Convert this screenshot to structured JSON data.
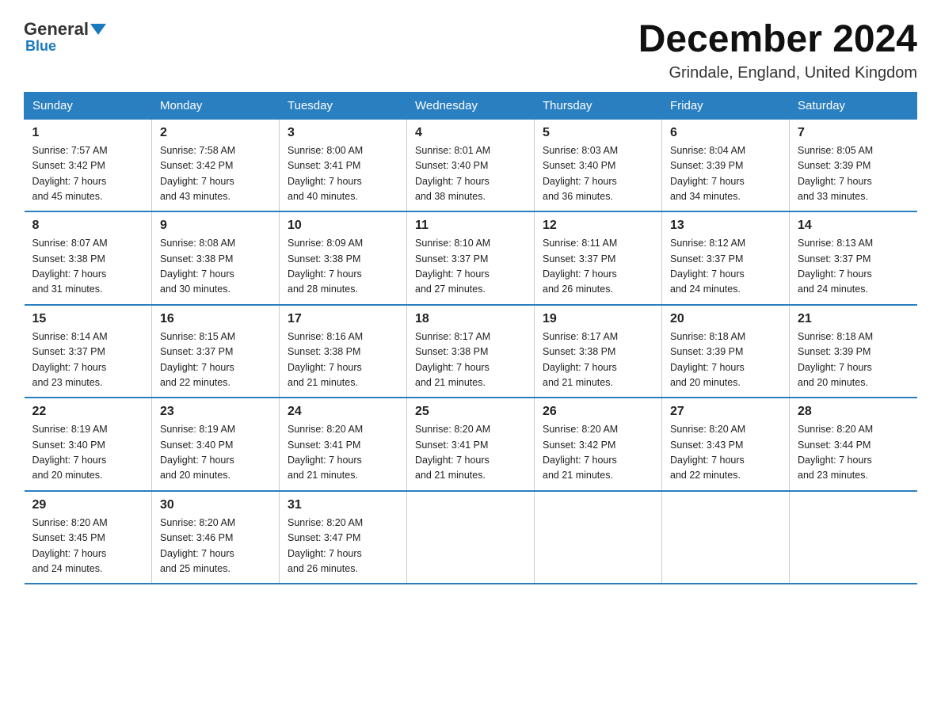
{
  "logo": {
    "general": "General",
    "blue": "Blue"
  },
  "title": "December 2024",
  "location": "Grindale, England, United Kingdom",
  "headers": [
    "Sunday",
    "Monday",
    "Tuesday",
    "Wednesday",
    "Thursday",
    "Friday",
    "Saturday"
  ],
  "weeks": [
    [
      {
        "day": "1",
        "sunrise": "7:57 AM",
        "sunset": "3:42 PM",
        "daylight": "7 hours and 45 minutes."
      },
      {
        "day": "2",
        "sunrise": "7:58 AM",
        "sunset": "3:42 PM",
        "daylight": "7 hours and 43 minutes."
      },
      {
        "day": "3",
        "sunrise": "8:00 AM",
        "sunset": "3:41 PM",
        "daylight": "7 hours and 40 minutes."
      },
      {
        "day": "4",
        "sunrise": "8:01 AM",
        "sunset": "3:40 PM",
        "daylight": "7 hours and 38 minutes."
      },
      {
        "day": "5",
        "sunrise": "8:03 AM",
        "sunset": "3:40 PM",
        "daylight": "7 hours and 36 minutes."
      },
      {
        "day": "6",
        "sunrise": "8:04 AM",
        "sunset": "3:39 PM",
        "daylight": "7 hours and 34 minutes."
      },
      {
        "day": "7",
        "sunrise": "8:05 AM",
        "sunset": "3:39 PM",
        "daylight": "7 hours and 33 minutes."
      }
    ],
    [
      {
        "day": "8",
        "sunrise": "8:07 AM",
        "sunset": "3:38 PM",
        "daylight": "7 hours and 31 minutes."
      },
      {
        "day": "9",
        "sunrise": "8:08 AM",
        "sunset": "3:38 PM",
        "daylight": "7 hours and 30 minutes."
      },
      {
        "day": "10",
        "sunrise": "8:09 AM",
        "sunset": "3:38 PM",
        "daylight": "7 hours and 28 minutes."
      },
      {
        "day": "11",
        "sunrise": "8:10 AM",
        "sunset": "3:37 PM",
        "daylight": "7 hours and 27 minutes."
      },
      {
        "day": "12",
        "sunrise": "8:11 AM",
        "sunset": "3:37 PM",
        "daylight": "7 hours and 26 minutes."
      },
      {
        "day": "13",
        "sunrise": "8:12 AM",
        "sunset": "3:37 PM",
        "daylight": "7 hours and 24 minutes."
      },
      {
        "day": "14",
        "sunrise": "8:13 AM",
        "sunset": "3:37 PM",
        "daylight": "7 hours and 24 minutes."
      }
    ],
    [
      {
        "day": "15",
        "sunrise": "8:14 AM",
        "sunset": "3:37 PM",
        "daylight": "7 hours and 23 minutes."
      },
      {
        "day": "16",
        "sunrise": "8:15 AM",
        "sunset": "3:37 PM",
        "daylight": "7 hours and 22 minutes."
      },
      {
        "day": "17",
        "sunrise": "8:16 AM",
        "sunset": "3:38 PM",
        "daylight": "7 hours and 21 minutes."
      },
      {
        "day": "18",
        "sunrise": "8:17 AM",
        "sunset": "3:38 PM",
        "daylight": "7 hours and 21 minutes."
      },
      {
        "day": "19",
        "sunrise": "8:17 AM",
        "sunset": "3:38 PM",
        "daylight": "7 hours and 21 minutes."
      },
      {
        "day": "20",
        "sunrise": "8:18 AM",
        "sunset": "3:39 PM",
        "daylight": "7 hours and 20 minutes."
      },
      {
        "day": "21",
        "sunrise": "8:18 AM",
        "sunset": "3:39 PM",
        "daylight": "7 hours and 20 minutes."
      }
    ],
    [
      {
        "day": "22",
        "sunrise": "8:19 AM",
        "sunset": "3:40 PM",
        "daylight": "7 hours and 20 minutes."
      },
      {
        "day": "23",
        "sunrise": "8:19 AM",
        "sunset": "3:40 PM",
        "daylight": "7 hours and 20 minutes."
      },
      {
        "day": "24",
        "sunrise": "8:20 AM",
        "sunset": "3:41 PM",
        "daylight": "7 hours and 21 minutes."
      },
      {
        "day": "25",
        "sunrise": "8:20 AM",
        "sunset": "3:41 PM",
        "daylight": "7 hours and 21 minutes."
      },
      {
        "day": "26",
        "sunrise": "8:20 AM",
        "sunset": "3:42 PM",
        "daylight": "7 hours and 21 minutes."
      },
      {
        "day": "27",
        "sunrise": "8:20 AM",
        "sunset": "3:43 PM",
        "daylight": "7 hours and 22 minutes."
      },
      {
        "day": "28",
        "sunrise": "8:20 AM",
        "sunset": "3:44 PM",
        "daylight": "7 hours and 23 minutes."
      }
    ],
    [
      {
        "day": "29",
        "sunrise": "8:20 AM",
        "sunset": "3:45 PM",
        "daylight": "7 hours and 24 minutes."
      },
      {
        "day": "30",
        "sunrise": "8:20 AM",
        "sunset": "3:46 PM",
        "daylight": "7 hours and 25 minutes."
      },
      {
        "day": "31",
        "sunrise": "8:20 AM",
        "sunset": "3:47 PM",
        "daylight": "7 hours and 26 minutes."
      },
      null,
      null,
      null,
      null
    ]
  ],
  "labels": {
    "sunrise": "Sunrise:",
    "sunset": "Sunset:",
    "daylight": "Daylight:"
  }
}
